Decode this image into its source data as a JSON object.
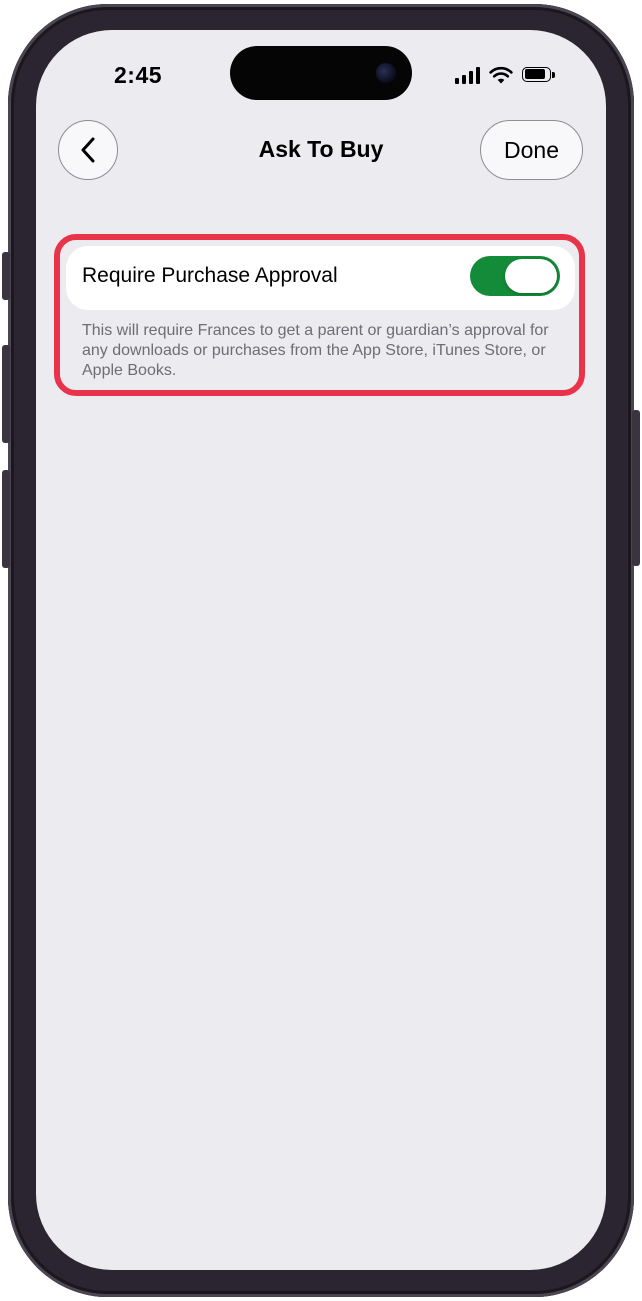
{
  "status_bar": {
    "time": "2:45",
    "icons": [
      "cellular-signal-icon",
      "wifi-icon",
      "battery-icon"
    ]
  },
  "nav": {
    "back_icon": "chevron-left-icon",
    "title": "Ask To Buy",
    "done_label": "Done"
  },
  "setting": {
    "label": "Require Purchase Approval",
    "toggle_on": true,
    "toggle_color": "#138b38",
    "footer": "This will require Frances to get a parent or guardian’s approval for any downloads or purchases from the App Store, iTunes Store, or Apple Books."
  },
  "highlight_color": "#e8334a"
}
